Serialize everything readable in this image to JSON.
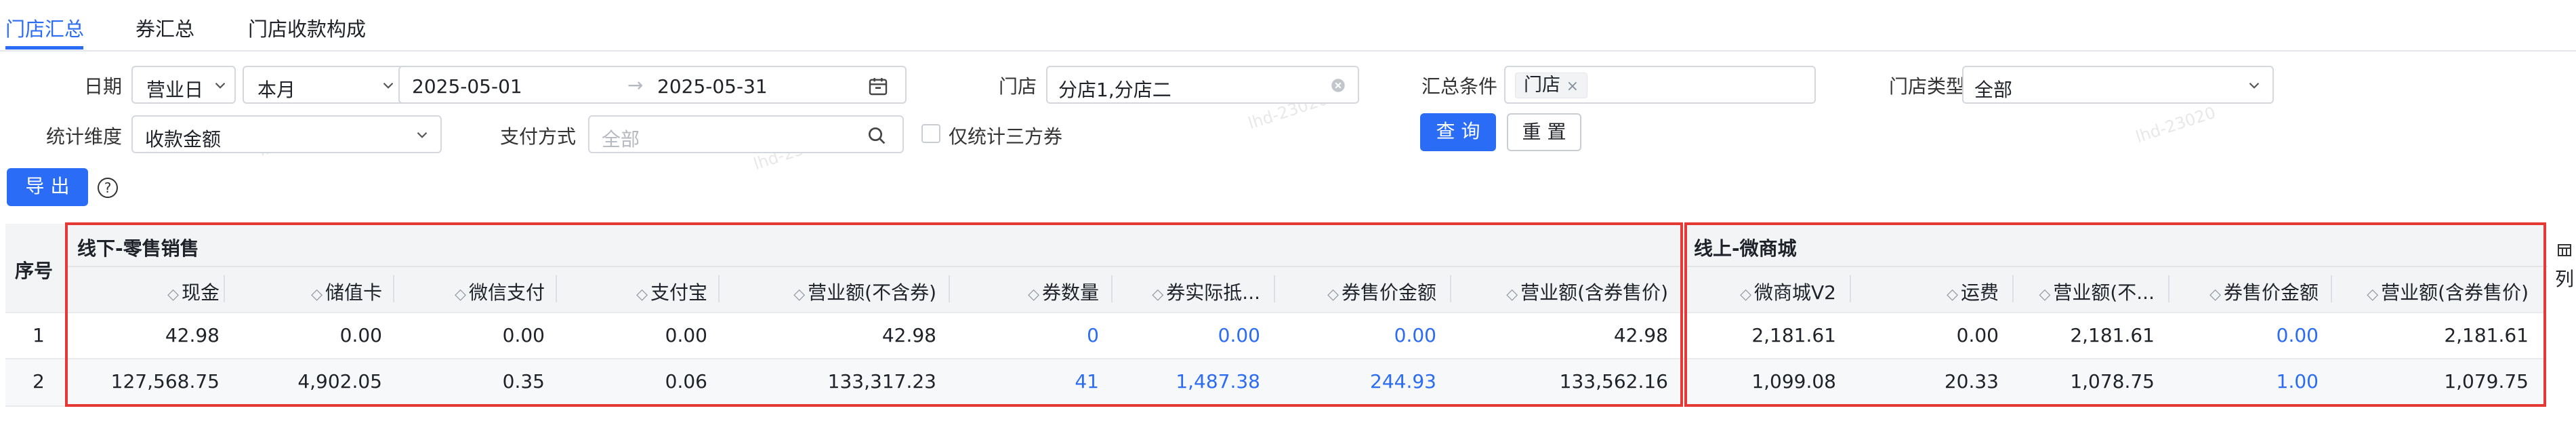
{
  "tabs": [
    {
      "label": "门店汇总"
    },
    {
      "label": "券汇总"
    },
    {
      "label": "门店收款构成"
    }
  ],
  "filters": {
    "date_label": "日期",
    "date_type": "营业日",
    "date_range_type": "本月",
    "start_date": "2025-05-01",
    "end_date": "2025-05-31",
    "store_label": "门店",
    "store_value": "分店1,分店二",
    "summary_label": "汇总条件",
    "summary_tag": "门店",
    "store_type_label": "门店类型",
    "store_type_value": "全部",
    "dimension_label": "统计维度",
    "dimension_value": "收款金额",
    "payment_label": "支付方式",
    "payment_placeholder": "全部",
    "third_party_label": "仅统计三方券",
    "query_button": "查 询",
    "reset_button": "重 置"
  },
  "toolbar": {
    "export_button": "导 出",
    "help_icon": "?"
  },
  "table": {
    "seq_header": "序号",
    "group1_title": "线下-零售销售",
    "group2_title": "线上-微商城",
    "columns_toggle": "列",
    "group1_columns": [
      "现金",
      "储值卡",
      "微信支付",
      "支付宝",
      "营业额(不含券)",
      "券数量",
      "券实际抵...",
      "券售价金额",
      "营业额(含券售价)"
    ],
    "group2_columns": [
      "微商城V2",
      "运费",
      "营业额(不...",
      "券售价金额",
      "营业额(含券售价)"
    ],
    "rows": [
      {
        "seq": "1",
        "g1": [
          "42.98",
          "0.00",
          "0.00",
          "0.00",
          "42.98",
          "0",
          "0.00",
          "0.00",
          "42.98"
        ],
        "g2": [
          "2,181.61",
          "0.00",
          "2,181.61",
          "0.00",
          "2,181.61"
        ]
      },
      {
        "seq": "2",
        "g1": [
          "127,568.75",
          "4,902.05",
          "0.35",
          "0.06",
          "133,317.23",
          "41",
          "1,487.38",
          "244.93",
          "133,562.16"
        ],
        "g2": [
          "1,099.08",
          "20.33",
          "1,078.75",
          "1.00",
          "1,079.75"
        ]
      }
    ]
  },
  "watermark": "lhd-23020",
  "colors": {
    "accent": "#2b6cf6",
    "highlight_border": "#e53935"
  }
}
